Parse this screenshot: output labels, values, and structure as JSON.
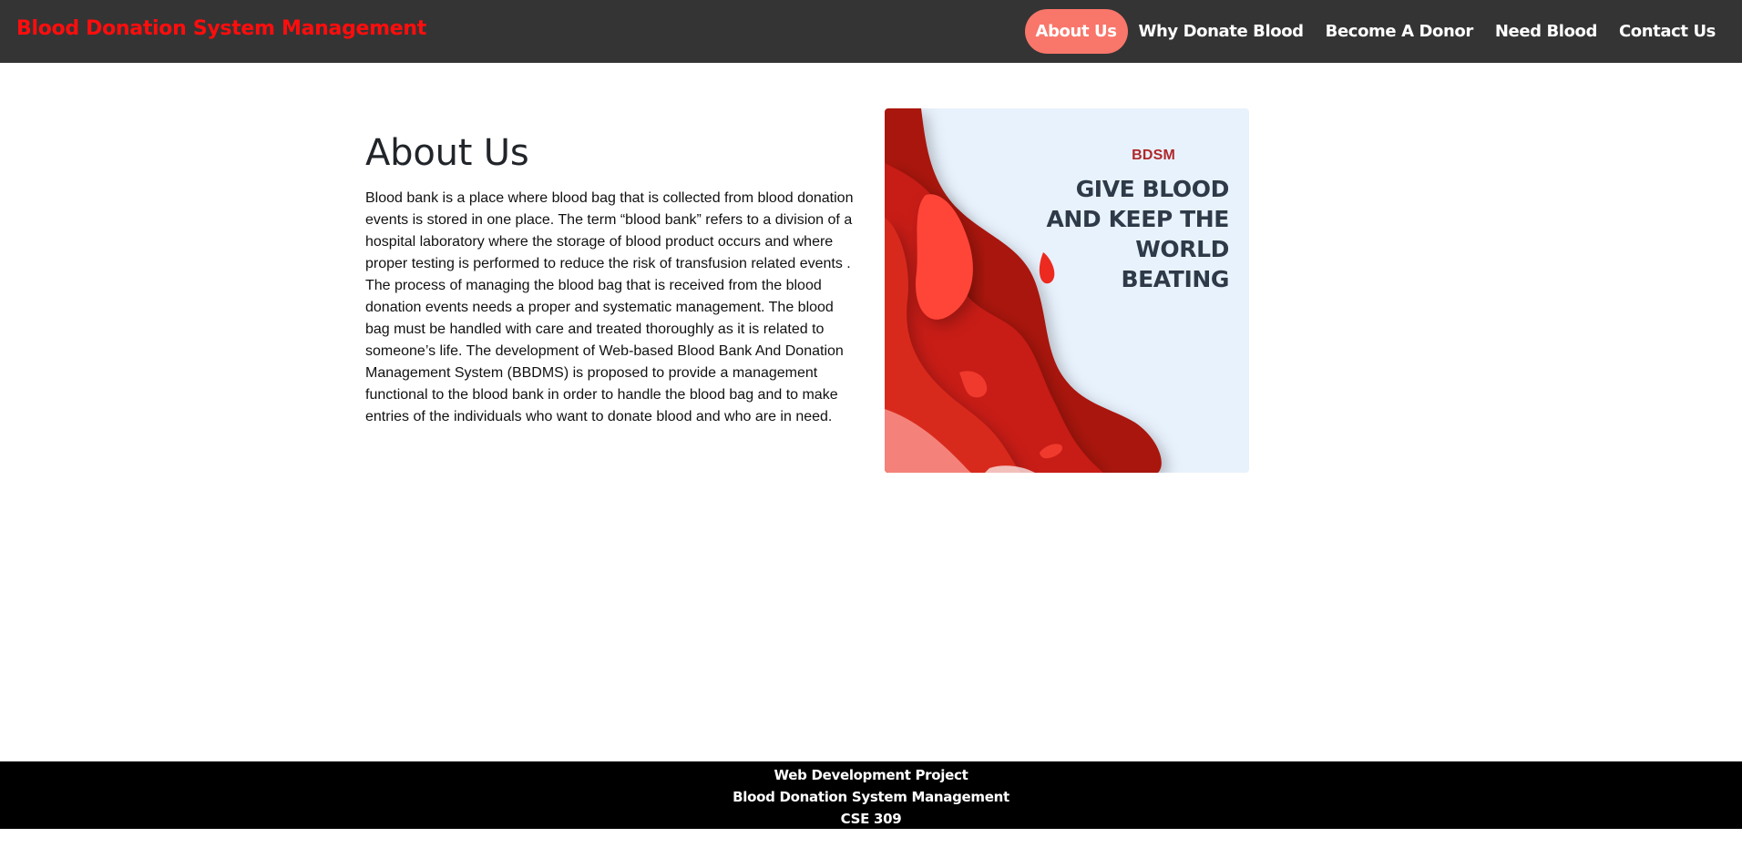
{
  "navbar": {
    "brand": "Blood Donation System Management",
    "links": [
      {
        "label": "About Us",
        "active": true
      },
      {
        "label": "Why Donate Blood",
        "active": false
      },
      {
        "label": "Become A Donor",
        "active": false
      },
      {
        "label": "Need Blood",
        "active": false
      },
      {
        "label": "Contact Us",
        "active": false
      }
    ]
  },
  "about": {
    "title": "About Us",
    "body": "Blood bank is a place where blood bag that is collected from blood donation events is stored in one place. The term “blood bank” refers to a division of a hospital laboratory where the storage of blood product occurs and where proper testing is performed to reduce the risk of transfusion related events . The process of managing the blood bag that is received from the blood donation events needs a proper and systematic management. The blood bag must be handled with care and treated thoroughly as it is related to someone’s life. The development of Web-based Blood Bank And Donation Management System (BBDMS) is proposed to provide a management functional to the blood bank in order to handle the blood bag and to make entries of the individuals who want to donate blood and who are in need."
  },
  "poster": {
    "tag": "BDSM",
    "headline": "GIVE BLOOD AND KEEP THE WORLD BEATING"
  },
  "footer": {
    "line1": "Web Development Project",
    "line2": "Blood Donation System Management",
    "line3": "CSE 309"
  },
  "colors": {
    "navbar_bg": "#343434",
    "brand": "#ff0d0d",
    "active_link_bg": "#f9766a",
    "footer_bg": "#000000",
    "poster_bg": "#e8f2fd"
  }
}
